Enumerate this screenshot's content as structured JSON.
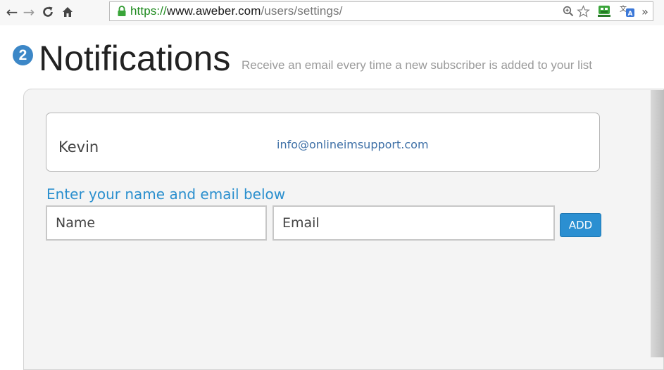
{
  "browser": {
    "url_scheme": "https://",
    "url_host": "www.aweber.com",
    "url_path": "/users/settings/",
    "overflow_label": "»",
    "icons": [
      "back-arrow-icon",
      "forward-arrow-icon",
      "reload-icon",
      "home-icon",
      "lock-icon",
      "zoom-icon",
      "star-icon",
      "extension-icon",
      "translate-icon"
    ]
  },
  "heading": {
    "step_number": "2",
    "title": "Notifications",
    "subtitle": "Receive an email every time a new subscriber is added to your list"
  },
  "subscriber": {
    "name": "Kevin",
    "email": "info@onlineimsupport.com"
  },
  "form": {
    "instruction": "Enter your name and email below",
    "name_placeholder": "Name",
    "email_placeholder": "Email",
    "add_label": "ADD"
  },
  "colors": {
    "accent": "#2b8fd1",
    "badge": "#3c87c7",
    "link": "#3d6fa6",
    "secure": "#1e8a1e"
  }
}
